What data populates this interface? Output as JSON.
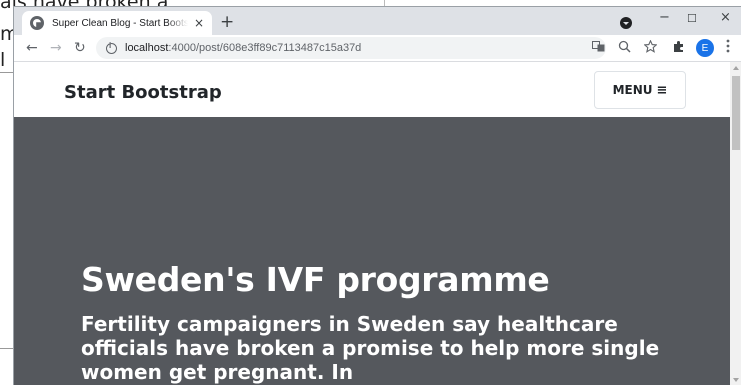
{
  "background_window": {
    "line1": "als have broken a",
    "line2": "m",
    "line3": "l"
  },
  "browser": {
    "tab": {
      "title": "Super Clean Blog - Start Bootstrap",
      "close": "×"
    },
    "new_tab": "+",
    "window_controls": {
      "minimize": "−",
      "maximize": "☐",
      "close": "×"
    },
    "nav": {
      "back": "←",
      "forward": "→",
      "reload": "↻"
    },
    "address": {
      "host": "localhost",
      "path": ":4000/post/608e3ff89c7113487c15a37d"
    },
    "profile_letter": "E"
  },
  "page": {
    "brand": "Start Bootstrap",
    "menu_label": "MENU",
    "menu_icon": "≡",
    "post_title": "Sweden's IVF programme",
    "post_subtitle": "Fertility campaigners in Sweden say healthcare officials have broken a promise to help more single women get pregnant. In"
  },
  "colors": {
    "masthead_bg": "#55585d",
    "titlebar_bg": "#dee1e6",
    "profile_avatar": "#1a73e8"
  }
}
